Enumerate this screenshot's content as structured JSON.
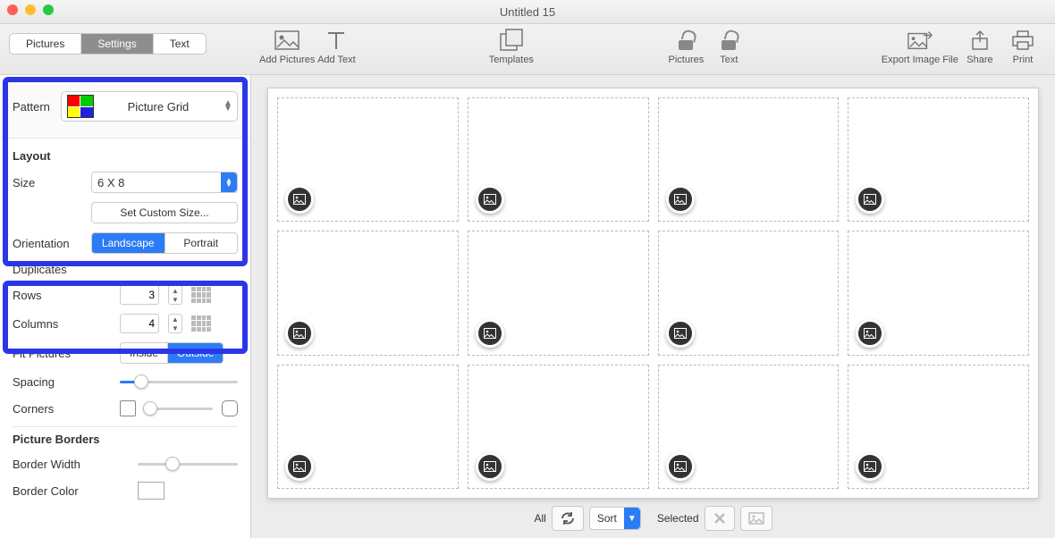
{
  "window": {
    "title": "Untitled 15"
  },
  "topTabs": {
    "pictures": "Pictures",
    "settings": "Settings",
    "text": "Text",
    "active": "settings"
  },
  "toolbar": {
    "addPictures": "Add Pictures",
    "addText": "Add Text",
    "templates": "Templates",
    "picturesLock": "Pictures",
    "textLock": "Text",
    "exportImage": "Export Image File",
    "share": "Share",
    "print": "Print"
  },
  "pattern": {
    "label": "Pattern",
    "value": "Picture Grid"
  },
  "layout": {
    "title": "Layout",
    "sizeLabel": "Size",
    "sizeValue": "6 X 8",
    "customSize": "Set Custom Size...",
    "orientationLabel": "Orientation",
    "landscape": "Landscape",
    "portrait": "Portrait",
    "orientationActive": "landscape",
    "duplicatesLabel": "Duplicates",
    "rowsLabel": "Rows",
    "rowsValue": "3",
    "columnsLabel": "Columns",
    "columnsValue": "4",
    "fitLabel": "Fit Pictures",
    "fitInside": "Inside",
    "fitOutside": "Outside",
    "fitActive": "outside",
    "spacingLabel": "Spacing",
    "cornersLabel": "Corners"
  },
  "borders": {
    "title": "Picture Borders",
    "widthLabel": "Border Width",
    "colorLabel": "Border Color"
  },
  "bottom": {
    "all": "All",
    "sort": "Sort",
    "selected": "Selected"
  },
  "grid": {
    "rows": 3,
    "cols": 4
  }
}
